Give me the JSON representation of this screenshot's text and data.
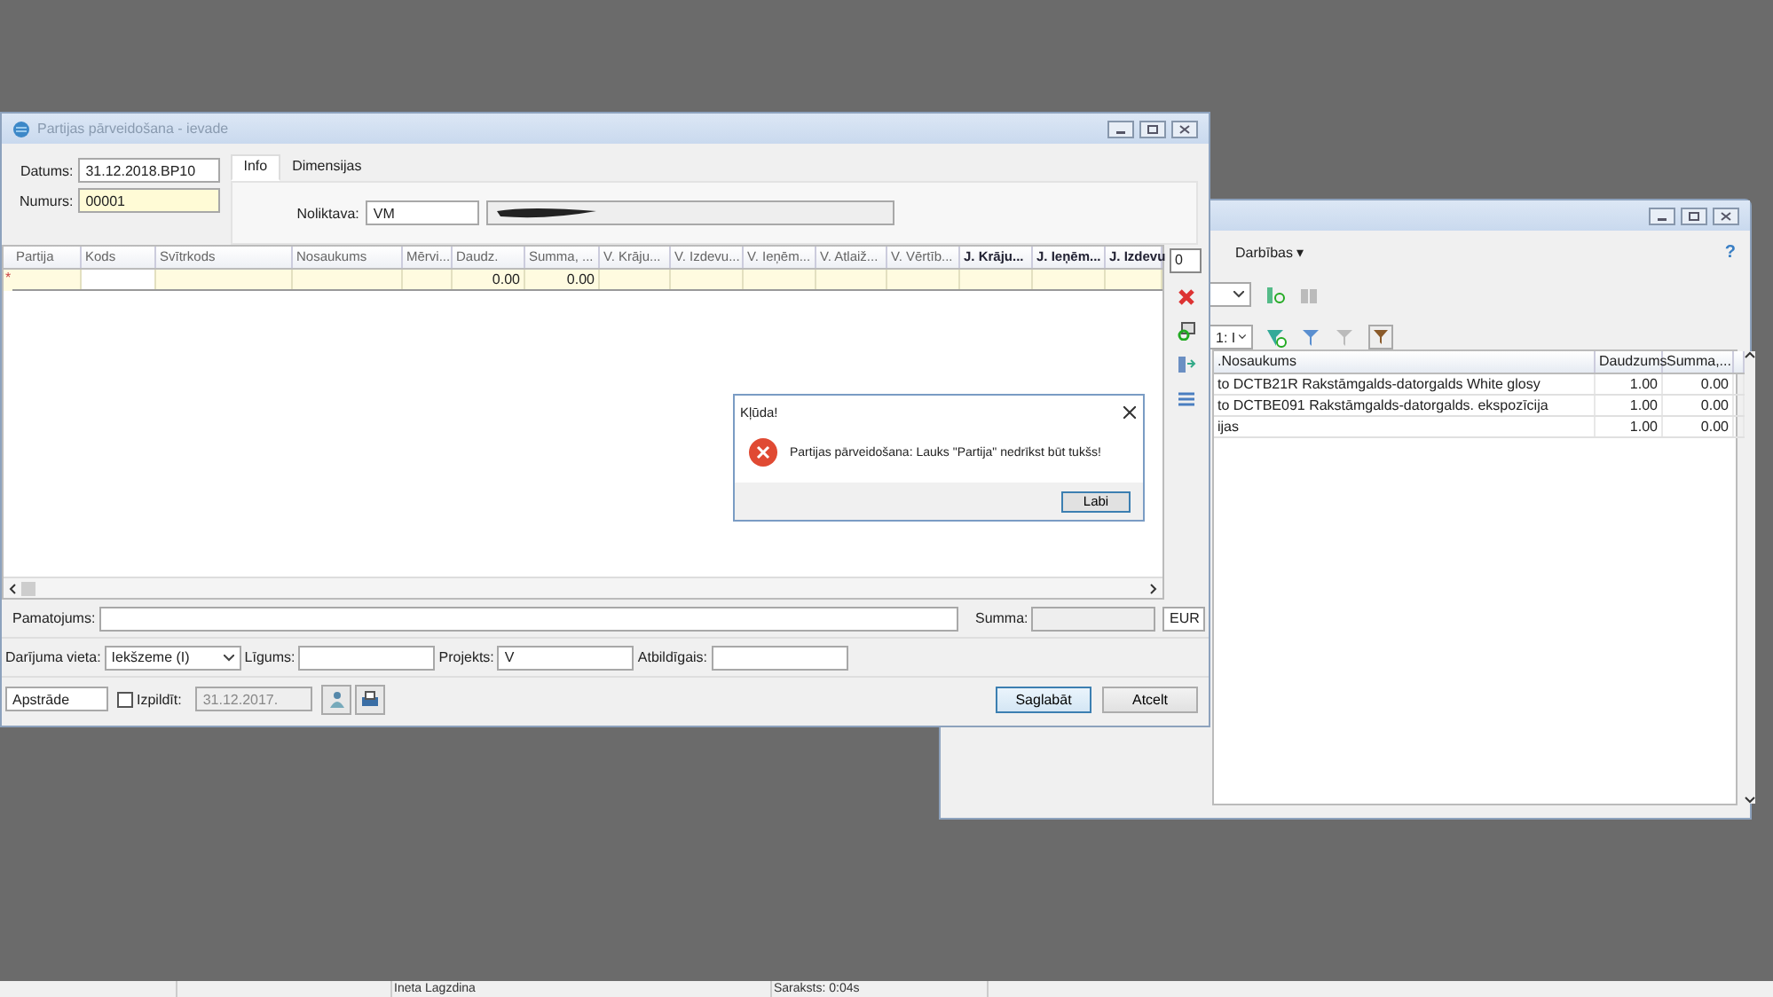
{
  "main_window": {
    "title": "Partijas pārveidošana - ievade",
    "fields": [
      {
        "label": "Datums:",
        "value": "31.12.2018.BP10"
      },
      {
        "label": "Numurs:",
        "value": "00001"
      }
    ],
    "tabs": [
      {
        "label": "Info",
        "selected": true
      },
      {
        "label": "Dimensijas",
        "selected": false
      }
    ],
    "warehouse": {
      "label": "Noliktava:",
      "value": "VM"
    },
    "table": {
      "columns": [
        {
          "label": "Partija",
          "bold": false
        },
        {
          "label": "Kods",
          "bold": false
        },
        {
          "label": "Svītrkods",
          "bold": false
        },
        {
          "label": "Nosaukums",
          "bold": false
        },
        {
          "label": "Mērvi...",
          "bold": false
        },
        {
          "label": "Daudz.",
          "bold": false
        },
        {
          "label": "Summa, ...",
          "bold": false
        },
        {
          "label": "V. Krāju...",
          "bold": false
        },
        {
          "label": "V. Izdevu...",
          "bold": false
        },
        {
          "label": "V. Ieņēm...",
          "bold": false
        },
        {
          "label": "V. Atlaiž...",
          "bold": false
        },
        {
          "label": "V. Vērtīb...",
          "bold": false
        },
        {
          "label": "J. Krāju...",
          "bold": true
        },
        {
          "label": "J. Ieņēm...",
          "bold": true
        },
        {
          "label": "J. Izdevu",
          "bold": true
        }
      ],
      "rows": [
        {
          "marker": "*",
          "cells": [
            "",
            "",
            "",
            "",
            "",
            "0.00",
            "0.00",
            "",
            "",
            "",
            "",
            "",
            "",
            "",
            ""
          ]
        }
      ]
    },
    "row_count": "0",
    "footer": {
      "reason": {
        "label": "Pamatojums:"
      },
      "sum": {
        "label": "Summa:",
        "currency": "EUR"
      },
      "place": {
        "label": "Darījuma vieta:",
        "value": "Iekšzeme (I)"
      },
      "contract": {
        "label": "Līgums:"
      },
      "project": {
        "label": "Projekts:",
        "value": "V"
      },
      "responsible": {
        "label": "Atbildīgais:"
      },
      "status": "Apstrāde",
      "execute": {
        "label": "Izpildīt:",
        "checked": false,
        "date": "31.12.2017."
      },
      "buttons": [
        {
          "label": "Saglabāt",
          "selected": true
        },
        {
          "label": "Atcelt",
          "selected": false
        }
      ]
    }
  },
  "list_window": {
    "menu": "Darbības ▾",
    "help": "?",
    "filter": "1: I",
    "columns": [
      ".Nosaukums",
      "Daudzums",
      "Summa,..."
    ],
    "rows": [
      {
        "cells": [
          "to DCTB21R Rakstāmgalds-datorgalds White glosy",
          "1.00",
          "0.00"
        ]
      },
      {
        "cells": [
          "to DCTBE091 Rakstāmgalds-datorgalds. ekspozīcija",
          "1.00",
          "0.00"
        ]
      },
      {
        "cells": [
          "ijas",
          "1.00",
          "0.00"
        ]
      }
    ]
  },
  "dialog": {
    "title": "Kļūda!",
    "message": "Partijas pārveidošana: Lauks \"Partija\" nedrīkst būt tukšs!",
    "button": "Labi"
  },
  "status_bar": [
    "Ineta Lagzdina",
    "Saraksts: 0:04s"
  ]
}
